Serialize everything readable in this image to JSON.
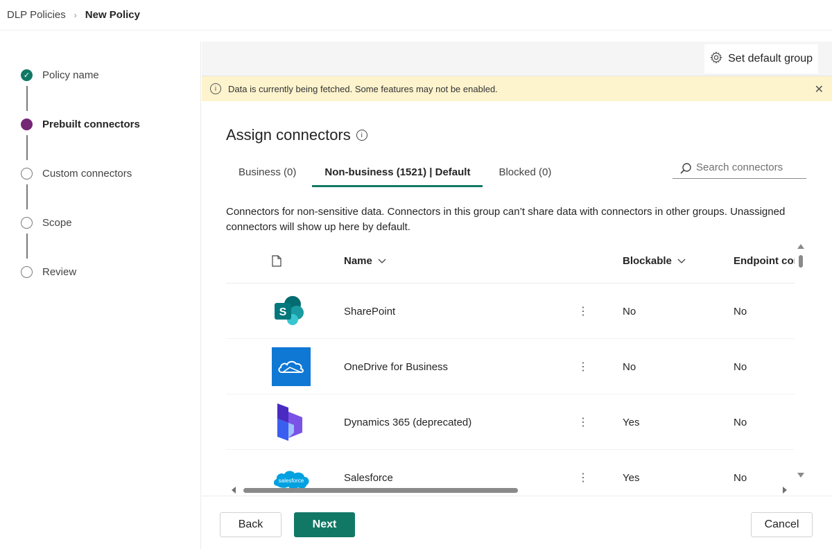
{
  "breadcrumb": {
    "parent": "DLP Policies",
    "current": "New Policy"
  },
  "steps": [
    {
      "label": "Policy name",
      "state": "done"
    },
    {
      "label": "Prebuilt connectors",
      "state": "active"
    },
    {
      "label": "Custom connectors",
      "state": "pending"
    },
    {
      "label": "Scope",
      "state": "pending"
    },
    {
      "label": "Review",
      "state": "pending"
    }
  ],
  "command_bar": {
    "set_default_label": "Set default group"
  },
  "warning": {
    "text": "Data is currently being fetched. Some features may not be enabled."
  },
  "section": {
    "title": "Assign connectors"
  },
  "tabs": [
    {
      "label": "Business (0)"
    },
    {
      "label": "Non-business (1521) | Default"
    },
    {
      "label": "Blocked (0)"
    }
  ],
  "search": {
    "placeholder": "Search connectors"
  },
  "description": "Connectors for non-sensitive data. Connectors in this group can’t share data with connectors in other groups. Unassigned connectors will show up here by default.",
  "table": {
    "columns": {
      "name": "Name",
      "blockable": "Blockable",
      "endpoint": "Endpoint cor"
    },
    "rows": [
      {
        "name": "SharePoint",
        "blockable": "No",
        "endpoint": "No",
        "icon": "sharepoint-icon"
      },
      {
        "name": "OneDrive for Business",
        "blockable": "No",
        "endpoint": "No",
        "icon": "onedrive-icon"
      },
      {
        "name": "Dynamics 365 (deprecated)",
        "blockable": "Yes",
        "endpoint": "No",
        "icon": "dynamics-icon"
      },
      {
        "name": "Salesforce",
        "blockable": "Yes",
        "endpoint": "No",
        "icon": "salesforce-icon",
        "logo_text": "salesforce"
      }
    ]
  },
  "footer": {
    "back": "Back",
    "next": "Next",
    "cancel": "Cancel"
  },
  "colors": {
    "accent": "#117865",
    "active_step": "#742774",
    "warning_bg": "#fdf3cd"
  }
}
